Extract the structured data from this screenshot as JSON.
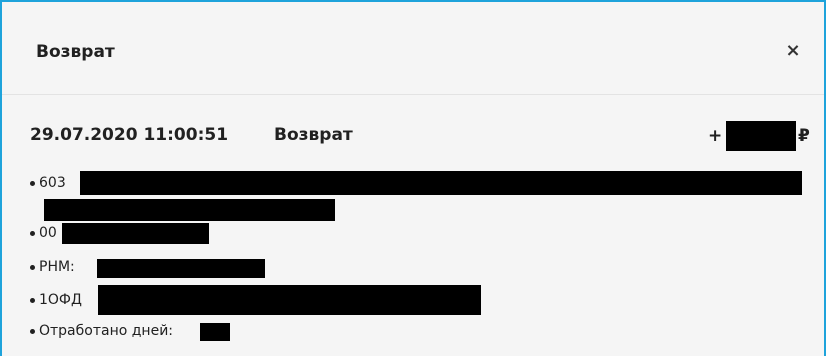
{
  "dialog": {
    "title": "Возврат",
    "close_icon": "close-icon",
    "close_glyph": "×"
  },
  "receipt": {
    "datetime": "29.07.2020 11:00:51",
    "operation": "Возврат",
    "amount_sign": "+",
    "currency": "₽",
    "details": [
      {
        "prefix": "603"
      },
      {
        "prefix": "00"
      },
      {
        "prefix": "РНМ:"
      },
      {
        "prefix": "1ОФД"
      },
      {
        "prefix": "Отработано дней:"
      }
    ]
  },
  "colors": {
    "accent_border": "#1ea3db",
    "background": "#f5f5f5",
    "text": "#212121",
    "redaction": "#000000"
  }
}
